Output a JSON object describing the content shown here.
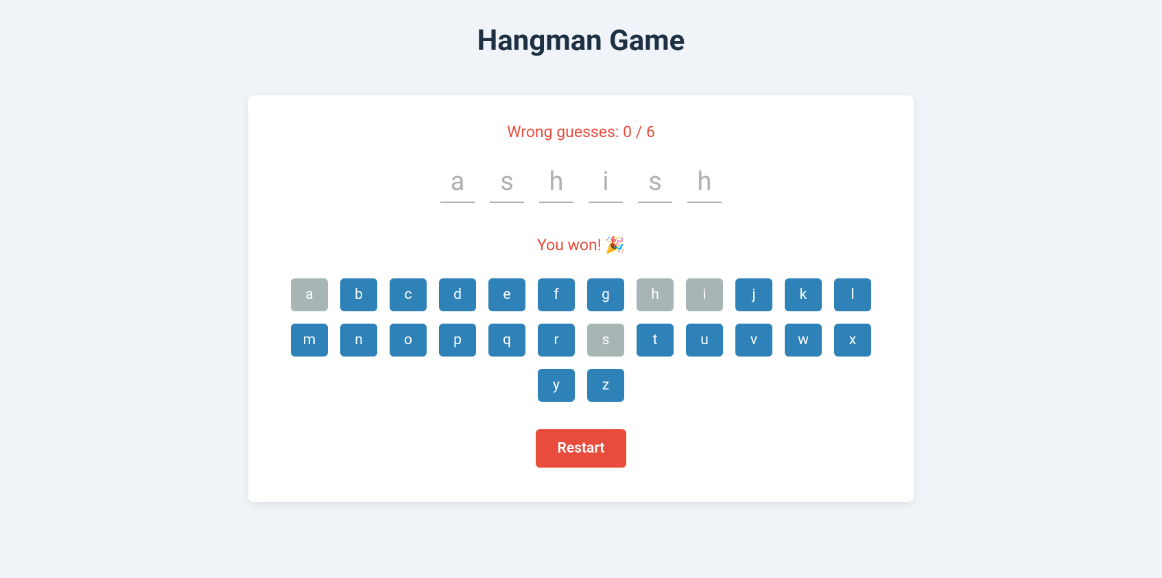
{
  "title": "Hangman Game",
  "wrong_guesses": {
    "label": "Wrong guesses: ",
    "count": "0",
    "sep": " / ",
    "max": "6"
  },
  "word_letters": [
    "a",
    "s",
    "h",
    "i",
    "s",
    "h"
  ],
  "status_message": "You won! 🎉",
  "keyboard": [
    {
      "letter": "a",
      "used": true
    },
    {
      "letter": "b",
      "used": false
    },
    {
      "letter": "c",
      "used": false
    },
    {
      "letter": "d",
      "used": false
    },
    {
      "letter": "e",
      "used": false
    },
    {
      "letter": "f",
      "used": false
    },
    {
      "letter": "g",
      "used": false
    },
    {
      "letter": "h",
      "used": true
    },
    {
      "letter": "i",
      "used": true
    },
    {
      "letter": "j",
      "used": false
    },
    {
      "letter": "k",
      "used": false
    },
    {
      "letter": "l",
      "used": false
    },
    {
      "letter": "m",
      "used": false
    },
    {
      "letter": "n",
      "used": false
    },
    {
      "letter": "o",
      "used": false
    },
    {
      "letter": "p",
      "used": false
    },
    {
      "letter": "q",
      "used": false
    },
    {
      "letter": "r",
      "used": false
    },
    {
      "letter": "s",
      "used": true
    },
    {
      "letter": "t",
      "used": false
    },
    {
      "letter": "u",
      "used": false
    },
    {
      "letter": "v",
      "used": false
    },
    {
      "letter": "w",
      "used": false
    },
    {
      "letter": "x",
      "used": false
    },
    {
      "letter": "y",
      "used": false
    },
    {
      "letter": "z",
      "used": false
    }
  ],
  "restart_label": "Restart"
}
